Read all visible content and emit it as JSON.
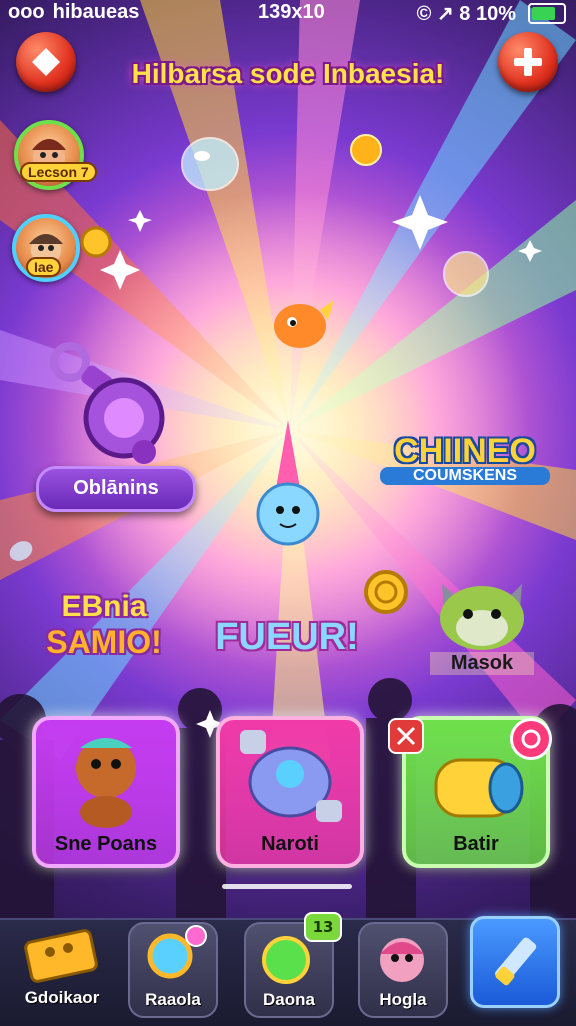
{
  "status_bar": {
    "carrier": "ooo  hibaueas",
    "time": "139x10",
    "right": "© ↗ 8 10%",
    "battery_level": 0.9
  },
  "header": {
    "title": "Hilbarsa sode Inbaesia!",
    "left_button_icon": "diamond-icon",
    "right_button_icon": "plus-icon"
  },
  "players": [
    {
      "tag": "Lecson 7"
    },
    {
      "tag": "Iae"
    }
  ],
  "world": {
    "pill_label": "Oblānins",
    "logo_right": {
      "line1": "CHIINEO",
      "line2": "COUMSKENS"
    },
    "logo_left": {
      "line1": "EBnia",
      "line2": "SAMIO!"
    },
    "logo_center": "FUEUR!",
    "creature_label": "Masok"
  },
  "cards": [
    {
      "label": "Sne Poans",
      "color": "#c53cf0"
    },
    {
      "label": "Naroti",
      "color": "#f03aa8"
    },
    {
      "label": "Batir",
      "color": "#6ee04a"
    }
  ],
  "dock": {
    "items": [
      {
        "label": "Gdoikaor",
        "icon": "ticket-icon"
      },
      {
        "label": "Raaola",
        "icon": "magnifier-icon"
      },
      {
        "label": "Daona",
        "icon": "green-orb-icon",
        "badge": "13"
      },
      {
        "label": "Hogla",
        "icon": "character-icon"
      },
      {
        "label": "",
        "icon": "brush-icon"
      }
    ]
  }
}
